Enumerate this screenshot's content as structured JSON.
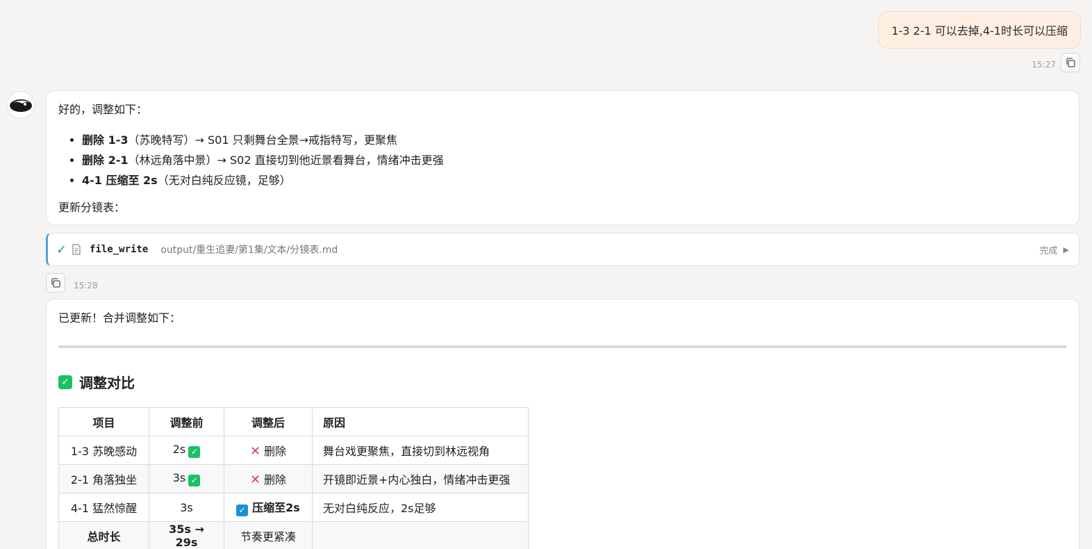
{
  "user_message": {
    "text": "1-3 2-1 可以去掉,4-1时长可以压缩",
    "time": "15:27"
  },
  "assistant_message_1": {
    "intro": "好的，调整如下：",
    "bullets": [
      {
        "bold": "删除 1-3",
        "rest": "（苏晚特写）→ S01 只剩舞台全景→戒指特写，更聚焦"
      },
      {
        "bold": "删除 2-1",
        "rest": "（林远角落中景）→ S02 直接切到他近景看舞台，情绪冲击更强"
      },
      {
        "bold": "4-1 压缩至 2s",
        "rest": "（无对白纯反应镜，足够）"
      }
    ],
    "outro": "更新分镜表："
  },
  "tool_call": {
    "name": "file_write",
    "path": "output/重生追妻/第1集/文本/分镜表.md",
    "status": "完成",
    "time": "15:28"
  },
  "assistant_message_2": {
    "intro": "已更新！合并调整如下：",
    "heading": "调整对比",
    "table": {
      "headers": [
        "项目",
        "调整前",
        "调整后",
        "原因"
      ],
      "rows": [
        {
          "item": "1-3 苏晚感动",
          "before": "2s",
          "after": "删除",
          "reason": "舞台戏更聚焦，直接切到林远视角"
        },
        {
          "item": "2-1 角落独坐",
          "before": "3s",
          "after": "删除",
          "reason": "开镜即近景+内心独白，情绪冲击更强"
        },
        {
          "item": "4-1 猛然惊醒",
          "before": "3s",
          "after": "压缩至2s",
          "reason": "无对白纯反应，2s足够"
        },
        {
          "item": "总时长",
          "before": "35s → 29s",
          "after": "节奏更紧凑",
          "reason": ""
        }
      ]
    }
  },
  "colors": {
    "accent_green": "#19c160",
    "accent_blue": "#1b8fd8",
    "delete_red": "#e03a5a",
    "user_bubble": "#fdf0e2"
  },
  "icons": [
    "copy-icon",
    "check-icon",
    "file-icon",
    "play-icon",
    "checkbox-icon",
    "cross-icon"
  ]
}
